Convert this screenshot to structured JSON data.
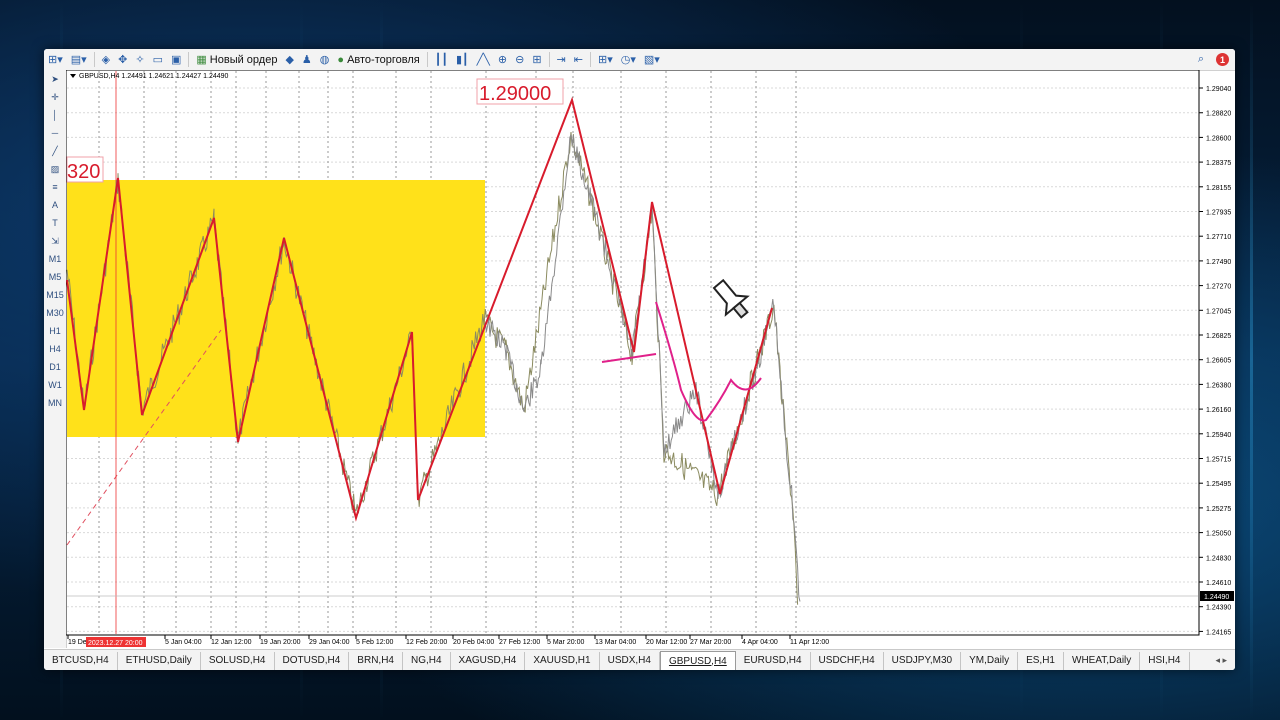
{
  "toolbar": {
    "new_order_label": "Новый ордер",
    "auto_trading_label": "Авто-торговля",
    "notification_count": "1"
  },
  "left_tools": [
    "M1",
    "M5",
    "M15",
    "M30",
    "H1",
    "H4",
    "D1",
    "W1",
    "MN"
  ],
  "chart": {
    "symbol_info": "GBPUSD,H4  1.24491 1.24621 1.24427 1.24490",
    "current_price_label": "1.24490",
    "price_labels": [
      "1.29040",
      "1.28820",
      "1.28600",
      "1.28375",
      "1.28155",
      "1.27935",
      "1.27710",
      "1.27490",
      "1.27270",
      "1.27045",
      "1.26825",
      "1.26605",
      "1.26380",
      "1.26160",
      "1.25940",
      "1.25715",
      "1.25495",
      "1.25275",
      "1.25050",
      "1.24830",
      "1.24610",
      "1.24390",
      "1.24165"
    ],
    "time_labels": [
      "19 Dec",
      "5 Jan 04:00",
      "12 Jan 12:00",
      "19 Jan 20:00",
      "29 Jan 04:00",
      "5 Feb 12:00",
      "12 Feb 20:00",
      "20 Feb 04:00",
      "27 Feb 12:00",
      "5 Mar 20:00",
      "13 Mar 04:00",
      "20 Mar 12:00",
      "27 Mar 20:00",
      "4 Apr 04:00",
      "11 Apr 12:00"
    ],
    "cursor_time_label": "2023.12.27 20:00",
    "annotation_high": "1.29000",
    "annotation_partial": "320",
    "colors": {
      "zigzag": "#d81b2c",
      "box": "#ffe11a",
      "price_line": "#8a8a8a",
      "highlight": "#e0208a"
    }
  },
  "tabs": [
    "BTCUSD,H4",
    "ETHUSD,Daily",
    "SOLUSD,H4",
    "DOTUSD,H4",
    "BRN,H4",
    "NG,H4",
    "XAGUSD,H4",
    "XAUUSD,H1",
    "USDX,H4",
    "GBPUSD,H4",
    "EURUSD,H4",
    "USDCHF,H4",
    "USDJPY,M30",
    "YM,Daily",
    "ES,H1",
    "WHEAT,Daily",
    "HSI,H4"
  ],
  "active_tab": "GBPUSD,H4"
}
